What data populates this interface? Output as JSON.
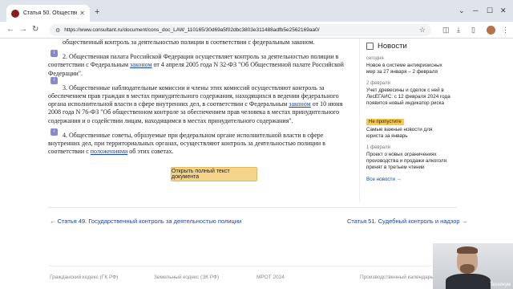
{
  "browser": {
    "tab_title": "Статья 50. Общественный кон",
    "url": "https://www.consultant.ru/document/cons_doc_LAW_110165/30d69a5f02dbc3803e311488adfb5e2562169aa0/"
  },
  "doc": {
    "p0": "общественный контроль за деятельностью полиции в соответствии с федеральным законом.",
    "p1_a": "2. Общественная палата Российской Федерации осуществляет контроль за деятельностью полиции в соответствии с Федеральным ",
    "p1_link": "законом",
    "p1_b": " от 4 апреля 2005 года N 32-ФЗ \"Об Общественной палате Российской Федерации\".",
    "p2_a": "3. Общественные наблюдательные комиссии и члены этих комиссий осуществляют контроль за обеспечением прав граждан в местах принудительного содержания, находящихся в ведении федерального органа исполнительной власти в сфере внутренних дел, в соответствии с Федеральным ",
    "p2_link": "законом",
    "p2_b": " от 10 июня 2008 года N 76-ФЗ \"Об общественном контроле за обеспечением прав человека в местах принудительного содержания и о содействии лицам, находящимся в местах принудительного содержания\".",
    "p3_a": "4. Общественные советы, образуемые при федеральном органе исполнительной власти в сфере внутренних дел, при территориальных органах, осуществляют контроль за деятельностью полиции в соответствии с ",
    "p3_link": "положениями",
    "p3_b": " об этих советах.",
    "full_text_button": "Открыть полный текст документа"
  },
  "news": {
    "title": "Новости",
    "items": [
      {
        "date": "сегодня",
        "text": "Новое в системе антикризисных мер за 27 января – 2 февраля"
      },
      {
        "date": "2 февраля",
        "text": "Учет древесины и сделок с ней в ЛесЕГАИС: с 12 февраля 2024 года появится новый индикатор риска"
      },
      {
        "badge": "Не пропустите",
        "text": "Самые важные новости для юриста за январь"
      },
      {
        "date": "1 февраля",
        "text": "Проект о новых ограничениях производства и продажи алкоголя принят в третьем чтении"
      }
    ],
    "all_link": "Все новости →"
  },
  "pager": {
    "prev": "← Статья 49. Государственный контроль за деятельностью полиции",
    "next": "Статья 51. Судебный контроль и надзор →"
  },
  "footer": {
    "links": [
      "Гражданский кодекс (ГК РФ)",
      "Земельный кодекс (ЗК РФ)",
      "МРОТ 2024",
      "Производственный календарь"
    ]
  },
  "webcam": {
    "label": "Технокум"
  },
  "colors": {
    "link": "#1a44a8",
    "button": "#f4d38a",
    "badge": "#f6c84c",
    "para_icon": "#8b87c9"
  }
}
